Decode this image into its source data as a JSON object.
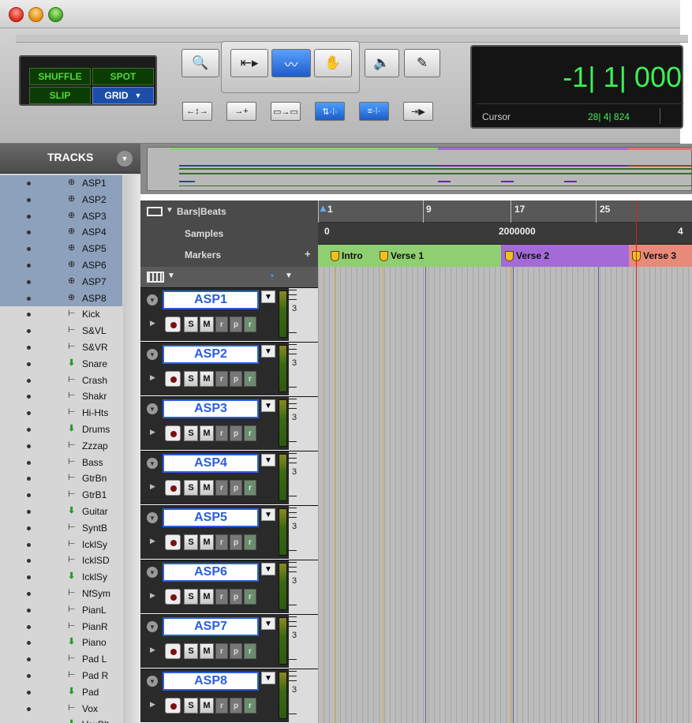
{
  "toolbar": {
    "modes": {
      "shuffle": "SHUFFLE",
      "spot": "SPOT",
      "slip": "SLIP",
      "grid": "GRID"
    },
    "tools": [
      "zoom-icon",
      "trim-icon",
      "selector-icon",
      "grabber-icon",
      "speaker-icon",
      "pencil-icon"
    ],
    "counter": {
      "main": "-1| 1| 000",
      "cursor_label": "Cursor",
      "cursor_value": "28| 4| 824"
    }
  },
  "tracks_panel": {
    "title": "TRACKS",
    "items": [
      {
        "name": "ASP1",
        "icon": "aux-icon",
        "selected": true
      },
      {
        "name": "ASP2",
        "icon": "aux-icon",
        "selected": true
      },
      {
        "name": "ASP3",
        "icon": "aux-icon",
        "selected": true
      },
      {
        "name": "ASP4",
        "icon": "aux-icon",
        "selected": true
      },
      {
        "name": "ASP5",
        "icon": "aux-icon",
        "selected": true
      },
      {
        "name": "ASP6",
        "icon": "aux-icon",
        "selected": true
      },
      {
        "name": "ASP7",
        "icon": "aux-icon",
        "selected": true
      },
      {
        "name": "ASP8",
        "icon": "aux-icon",
        "selected": true
      },
      {
        "name": "Kick",
        "icon": "audio-track-icon",
        "selected": false
      },
      {
        "name": "S&VL",
        "icon": "audio-track-icon",
        "selected": false
      },
      {
        "name": "S&VR",
        "icon": "audio-track-icon",
        "selected": false
      },
      {
        "name": "Snare",
        "icon": "folder-arrow-icon",
        "selected": false
      },
      {
        "name": "Crash",
        "icon": "audio-track-icon",
        "selected": false
      },
      {
        "name": "Shakr",
        "icon": "audio-track-icon",
        "selected": false
      },
      {
        "name": "Hi-Hts",
        "icon": "audio-track-icon",
        "selected": false
      },
      {
        "name": "Drums",
        "icon": "folder-arrow-icon",
        "selected": false
      },
      {
        "name": "Zzzap",
        "icon": "audio-track-icon",
        "selected": false
      },
      {
        "name": "Bass",
        "icon": "audio-track-icon",
        "selected": false
      },
      {
        "name": "GtrBn",
        "icon": "audio-track-icon",
        "selected": false
      },
      {
        "name": "GtrB1",
        "icon": "audio-track-icon",
        "selected": false
      },
      {
        "name": "Guitar",
        "icon": "folder-arrow-icon",
        "selected": false
      },
      {
        "name": "SyntB",
        "icon": "audio-track-icon",
        "selected": false
      },
      {
        "name": "IcklSy",
        "icon": "audio-track-icon",
        "selected": false
      },
      {
        "name": "IcklSD",
        "icon": "audio-track-icon",
        "selected": false
      },
      {
        "name": "IcklSy",
        "icon": "folder-arrow-icon",
        "selected": false
      },
      {
        "name": "NfSym",
        "icon": "audio-track-icon",
        "selected": false
      },
      {
        "name": "PianL",
        "icon": "audio-track-icon",
        "selected": false
      },
      {
        "name": "PianR",
        "icon": "audio-track-icon",
        "selected": false
      },
      {
        "name": "Piano",
        "icon": "folder-arrow-icon",
        "selected": false
      },
      {
        "name": "Pad L",
        "icon": "audio-track-icon",
        "selected": false
      },
      {
        "name": "Pad R",
        "icon": "audio-track-icon",
        "selected": false
      },
      {
        "name": "Pad",
        "icon": "folder-arrow-icon",
        "selected": false
      },
      {
        "name": "Vox",
        "icon": "audio-track-icon",
        "selected": false
      },
      {
        "name": "VoxBlt",
        "icon": "folder-arrow-icon",
        "selected": false
      }
    ]
  },
  "rulers": {
    "bars_beats_label": "Bars|Beats",
    "samples_label": "Samples",
    "markers_label": "Markers",
    "bar_ticks": [
      "1",
      "9",
      "17",
      "25"
    ],
    "sample_ticks": [
      "0",
      "2000000",
      "4"
    ],
    "markers": [
      "Intro",
      "Verse 1",
      "Verse 2",
      "Verse 3"
    ]
  },
  "edit_tracks": [
    {
      "name": "ASP1",
      "timebase": "3"
    },
    {
      "name": "ASP2",
      "timebase": "3"
    },
    {
      "name": "ASP3",
      "timebase": "3"
    },
    {
      "name": "ASP4",
      "timebase": "3"
    },
    {
      "name": "ASP5",
      "timebase": "3"
    },
    {
      "name": "ASP6",
      "timebase": "3"
    },
    {
      "name": "ASP7",
      "timebase": "3"
    },
    {
      "name": "ASP8",
      "timebase": "3"
    }
  ],
  "track_buttons": {
    "solo": "S",
    "mute": "M",
    "read": "r",
    "playlist": "p",
    "record_ready": "r"
  },
  "colors": {
    "selected_row": "#8da0bc",
    "track_name": "#2b5edc",
    "counter_green": "#3cf058",
    "playhead": "#d42020"
  }
}
